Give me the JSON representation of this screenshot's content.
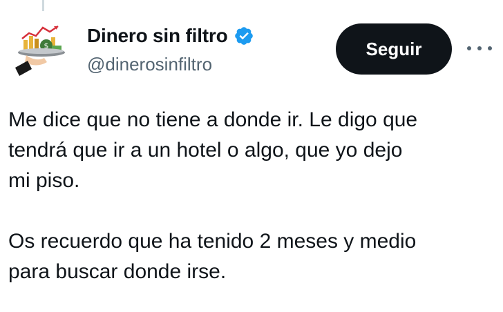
{
  "author": {
    "display_name": "Dinero sin filtro",
    "handle": "@dinerosinfiltro",
    "avatar_icon": "money-tray-chart-icon",
    "verified_icon": "verified-badge-icon"
  },
  "actions": {
    "follow_label": "Seguir",
    "more_icon": "more-options-icon"
  },
  "tweet": {
    "paragraph_1": "Me dice que no tiene a donde ir. Le digo que\ntendrá que ir a un hotel o algo, que yo dejo\nmi piso.",
    "paragraph_2": "Os recuerdo que ha tenido 2 meses y medio\npara buscar donde irse."
  },
  "colors": {
    "text_primary": "#0f1419",
    "text_secondary": "#536471",
    "verified_blue": "#1d9bf0",
    "button_bg": "#0f1419"
  }
}
